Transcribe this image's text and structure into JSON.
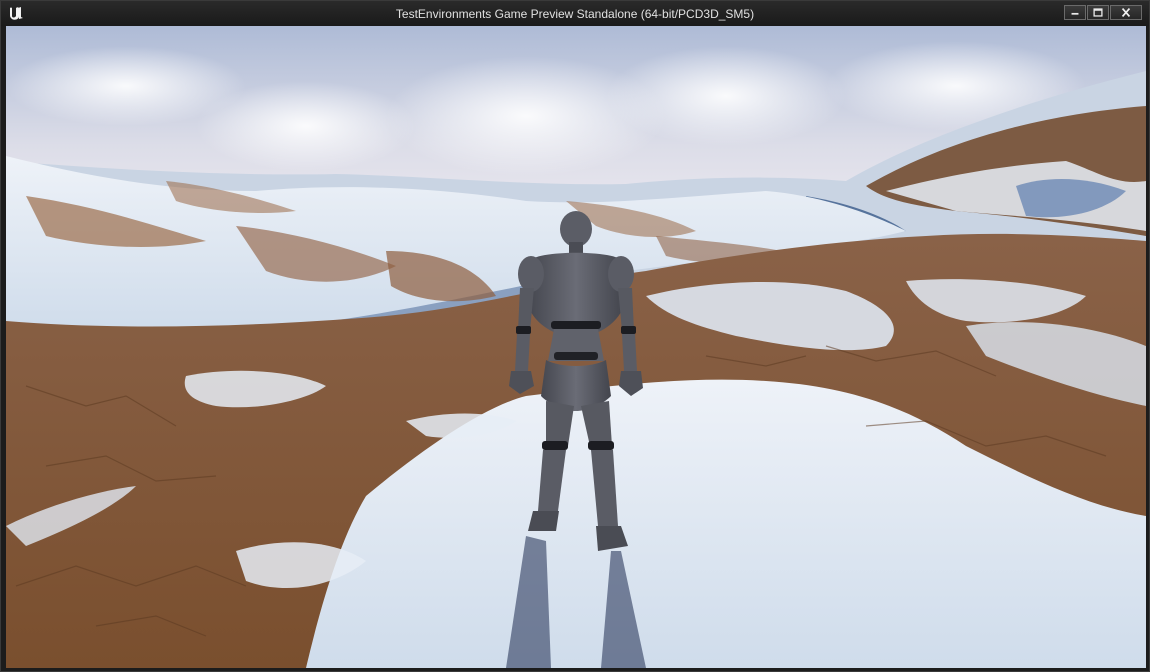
{
  "window": {
    "title": "TestEnvironments Game Preview Standalone (64-bit/PCD3D_SM5)",
    "logo_icon": "unreal-engine-logo-icon",
    "controls": [
      {
        "name": "minimize",
        "icon": "minimize-icon"
      },
      {
        "name": "maximize",
        "icon": "maximize-icon"
      },
      {
        "name": "close",
        "icon": "close-icon"
      }
    ]
  },
  "scene": {
    "description_tags": [
      "sky",
      "snowy-hills",
      "dirt-terrain",
      "mannequin-character",
      "shadow"
    ],
    "colors": {
      "sky_top": "#b7c3dd",
      "sky_bottom": "#e9e6ef",
      "snow": "#e4ecf5",
      "dirt": "#8a5a36",
      "mannequin": "#5b5d66"
    }
  }
}
